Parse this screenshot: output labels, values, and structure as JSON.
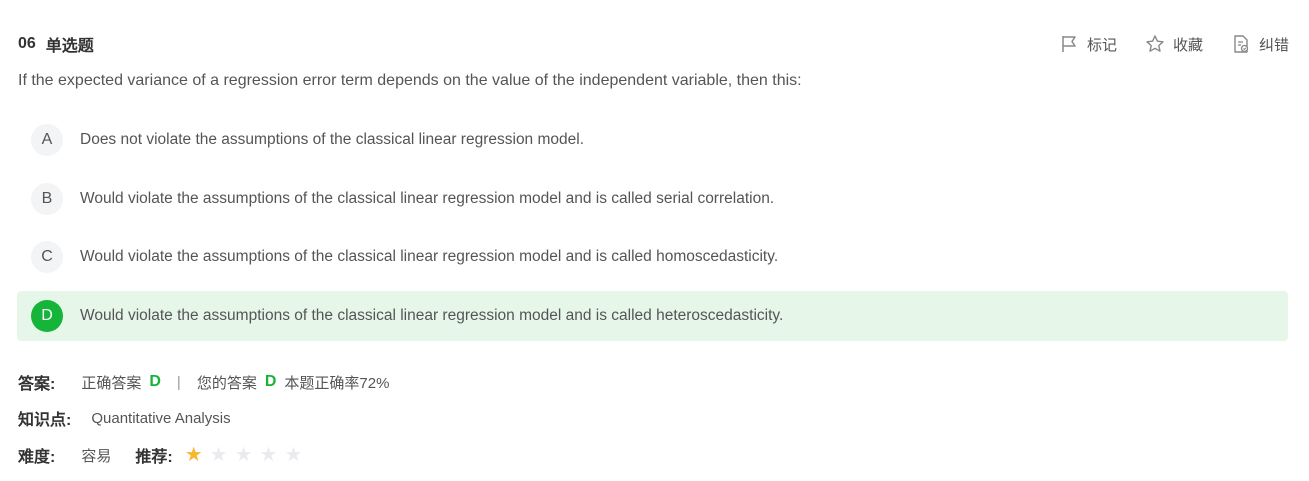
{
  "question": {
    "number": "06",
    "type": "单选题",
    "stem": "If the expected variance of a regression error term depends on the value of the independent variable, then this:"
  },
  "tools": {
    "mark": "标记",
    "favorite": "收藏",
    "report": "纠错"
  },
  "options": [
    {
      "letter": "A",
      "text": "Does not violate the assumptions of the classical linear regression model."
    },
    {
      "letter": "B",
      "text": "Would violate the assumptions of the classical linear regression model and is called serial correlation."
    },
    {
      "letter": "C",
      "text": "Would violate the assumptions of the classical linear regression model and is called homoscedasticity."
    },
    {
      "letter": "D",
      "text": "Would violate the assumptions of the classical linear regression model and is called heteroscedasticity."
    }
  ],
  "selected_option": "D",
  "answer": {
    "label": "答案:",
    "correct_label": "正确答案",
    "correct_value": "D",
    "separator": "|",
    "yours_label": "您的答案",
    "yours_value": "D",
    "rate_text": "本题正确率72%"
  },
  "knowledge": {
    "label": "知识点:",
    "value": "Quantitative Analysis"
  },
  "difficulty": {
    "label": "难度:",
    "value": "容易",
    "recommend_label": "推荐:",
    "rating": 1,
    "rating_max": 5
  },
  "colors": {
    "accent_green": "#15b53a",
    "selected_bg": "#e6f7ea",
    "star_on": "#f7b731",
    "star_off": "#e9ebef"
  }
}
